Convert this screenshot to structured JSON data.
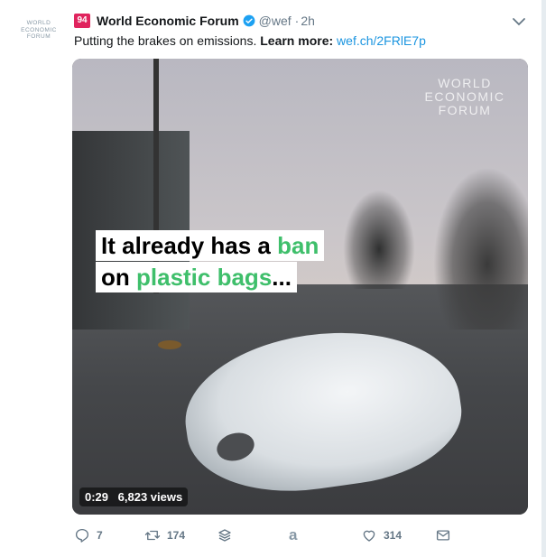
{
  "tweet": {
    "avatar_text": [
      "WORLD",
      "ECONOMIC",
      "FORUM"
    ],
    "badge": "94",
    "author": "World Economic Forum",
    "handle": "@wef",
    "separator": "·",
    "time": "2h",
    "text": "Putting the brakes on emissions.",
    "learn_more": "Learn more:",
    "link": "wef.ch/2FRlE7p"
  },
  "media": {
    "watermark": [
      "WORLD",
      "ECONOMIC",
      "FORUM"
    ],
    "overlay_line1_a": "It already has a ",
    "overlay_line1_b": "ban",
    "overlay_line2_a": "on ",
    "overlay_line2_b": "plastic bags",
    "overlay_line2_c": "...",
    "duration": "0:29",
    "views": "6,823 views"
  },
  "actions": {
    "replies": "7",
    "retweets": "174",
    "likes": "314",
    "buffer_glyph": "a"
  },
  "colors": {
    "link": "#1b95e0",
    "verified": "#1da1f2",
    "badge": "#e0245e",
    "overlay_green": "#3fbf6b"
  }
}
